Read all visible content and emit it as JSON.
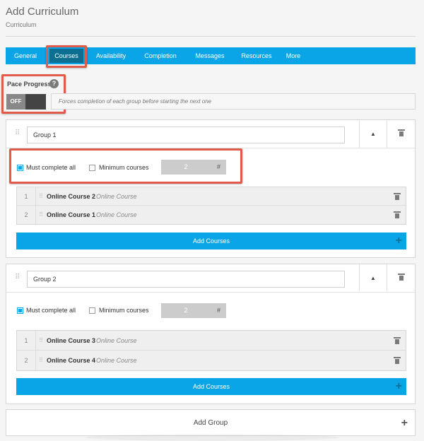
{
  "header": {
    "title": "Add Curriculum",
    "subtitle": "Curriculum"
  },
  "tabs": [
    {
      "label": "General"
    },
    {
      "label": "Courses",
      "active": true
    },
    {
      "label": "Availability"
    },
    {
      "label": "Completion"
    },
    {
      "label": "Messages"
    },
    {
      "label": "Resources"
    },
    {
      "label": "More"
    }
  ],
  "pace": {
    "label": "Pace Progress",
    "help": "?",
    "toggle": "OFF",
    "description": "Forces completion of each group before starting the next one"
  },
  "groups": [
    {
      "name": "Group 1",
      "must_complete_label": "Must complete all",
      "minimum_label": "Minimum courses",
      "minimum_value": "2",
      "minimum_unit": "#",
      "courses": [
        {
          "index": "1",
          "name": "Online Course 2",
          "type": "Online Course"
        },
        {
          "index": "2",
          "name": "Online Course 1",
          "type": "Online Course"
        }
      ],
      "add_courses_label": "Add Courses"
    },
    {
      "name": "Group 2",
      "must_complete_label": "Must complete all",
      "minimum_label": "Minimum courses",
      "minimum_value": "2",
      "minimum_unit": "#",
      "courses": [
        {
          "index": "1",
          "name": "Online Course 3",
          "type": "Online Course"
        },
        {
          "index": "2",
          "name": "Online Course 4",
          "type": "Online Course"
        }
      ],
      "add_courses_label": "Add Courses"
    }
  ],
  "add_group_label": "Add Group",
  "plus_glyph": "+",
  "drag_glyph": "⠿",
  "collapse_glyph": "▲",
  "colors": {
    "accent": "#0aa5e6",
    "active_tab": "#0b6f92",
    "highlight": "#e05b4c"
  }
}
